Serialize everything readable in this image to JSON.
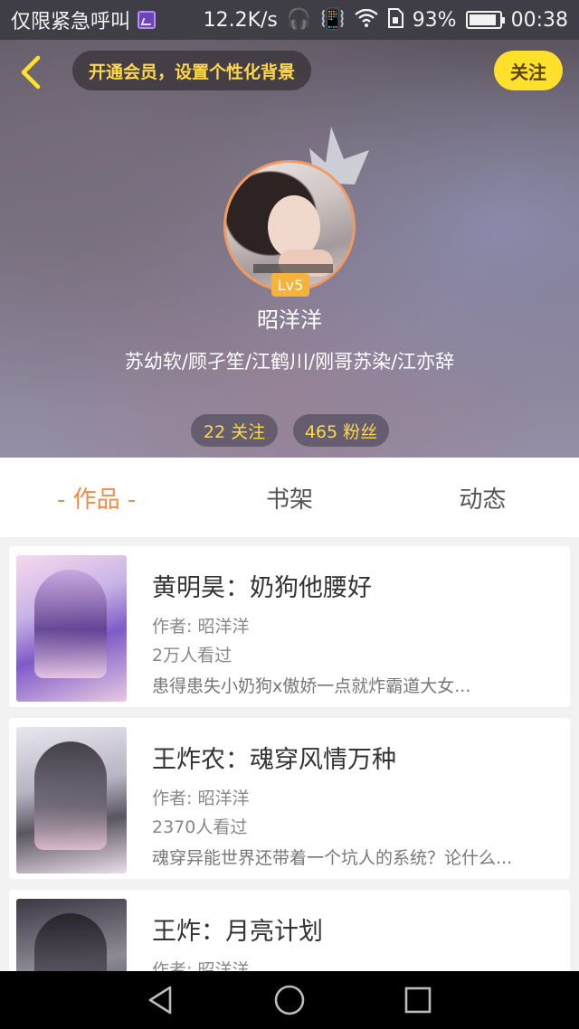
{
  "status_bar": {
    "carrier": "仅限紧急呼叫",
    "speed": "12.2K/s",
    "battery": "93%",
    "battery_level": 0.93,
    "time": "00:38",
    "icons": [
      "image-notification-icon",
      "headphones-icon",
      "vibrate-icon",
      "wifi-icon",
      "sim-icon",
      "battery-icon"
    ]
  },
  "header": {
    "vip_prompt": "开通会员，设置个性化背景",
    "follow_label": "关注",
    "level": "Lv5",
    "username": "昭洋洋",
    "tags": "苏幼软/顾孑笙/江鹤川/刚哥苏染/江亦辞",
    "following": "22 关注",
    "fans": "465 粉丝"
  },
  "tabs": [
    {
      "label": "- 作品 -",
      "active": true
    },
    {
      "label": "书架",
      "active": false
    },
    {
      "label": "动态",
      "active": false
    }
  ],
  "books": [
    {
      "title": "黄明昊：奶狗他腰好",
      "author": "作者: 昭洋洋",
      "views": "2万人看过",
      "desc": "患得患失小奶狗x傲娇一点就炸霸道大女..."
    },
    {
      "title": "王炸农：魂穿风情万种",
      "author": "作者: 昭洋洋",
      "views": "2370人看过",
      "desc": "魂穿异能世界还带着一个坑人的系统？论什么..."
    },
    {
      "title": "王炸：月亮计划",
      "author": "作者: 昭洋洋",
      "views": "",
      "desc": ""
    }
  ],
  "colors": {
    "accent": "#f28a4a",
    "follow_bg": "#ffe02a",
    "gold_text": "#ffd84a"
  }
}
